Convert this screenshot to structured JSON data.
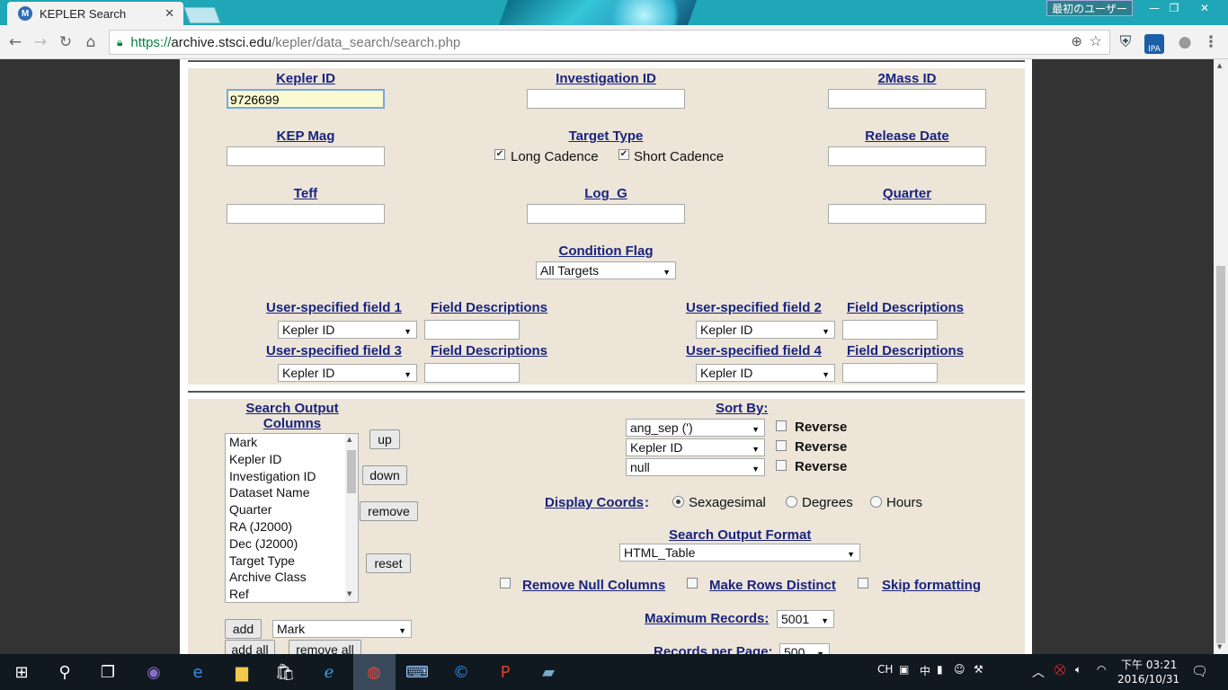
{
  "browser": {
    "tab_title": "KEPLER Search",
    "tab_icon_letter": "M",
    "profile_button": "最初のユーザー",
    "url_scheme": "https://",
    "url_host": "archive.stsci.edu",
    "url_path": "/kepler/data_search/search.php",
    "ext_label": "IPA"
  },
  "form": {
    "kepler_id_label": "Kepler ID",
    "kepler_id_value": "9726699",
    "investigation_id_label": "Investigation ID",
    "twomass_id_label": "2Mass ID",
    "kep_mag_label": "KEP Mag",
    "target_type_label": "Target Type",
    "long_cadence_label": "Long Cadence",
    "short_cadence_label": "Short Cadence",
    "release_date_label": "Release Date",
    "teff_label": "Teff",
    "log_g_label": "Log_G",
    "quarter_label": "Quarter",
    "condition_flag_label": "Condition Flag",
    "condition_flag_value": "All Targets",
    "user_fields": [
      {
        "label": "User-specified field 1",
        "desc_label": "Field Descriptions",
        "value": "Kepler ID"
      },
      {
        "label": "User-specified field 2",
        "desc_label": "Field Descriptions",
        "value": "Kepler ID"
      },
      {
        "label": "User-specified field 3",
        "desc_label": "Field Descriptions",
        "value": "Kepler ID"
      },
      {
        "label": "User-specified field 4",
        "desc_label": "Field Descriptions",
        "value": "Kepler ID"
      }
    ]
  },
  "output": {
    "columns_label_line1": "Search Output",
    "columns_label_line2": "Columns",
    "columns": [
      "Mark",
      "Kepler ID",
      "Investigation ID",
      "Dataset Name",
      "Quarter",
      "RA (J2000)",
      "Dec (J2000)",
      "Target Type",
      "Archive Class",
      "Ref"
    ],
    "up_button": "up",
    "down_button": "down",
    "remove_button": "remove",
    "reset_button": "reset",
    "add_button": "add",
    "add_select_value": "Mark",
    "add_all_button": "add all",
    "remove_all_button": "remove all",
    "sort_by_label": "Sort By:",
    "sort": [
      {
        "value": "ang_sep (')",
        "reverse_label": "Reverse"
      },
      {
        "value": "Kepler ID",
        "reverse_label": "Reverse"
      },
      {
        "value": "null",
        "reverse_label": "Reverse"
      }
    ],
    "display_coords_label": "Display Coords",
    "display_coords_colon": ":",
    "coords_options": [
      "Sexagesimal",
      "Degrees",
      "Hours"
    ],
    "format_label": "Search Output Format",
    "format_value": "HTML_Table",
    "remove_null_label": "Remove Null Columns",
    "distinct_label": "Make Rows Distinct",
    "skip_format_label": "Skip formatting",
    "max_records_label": "Maximum Records:",
    "max_records_value": "5001",
    "records_per_page_label": "Records per Page:",
    "records_per_page_value": "500"
  },
  "taskbar": {
    "ime_mode": "CH",
    "ime_lang": "中",
    "time": "下午 03:21",
    "date": "2016/10/31"
  }
}
